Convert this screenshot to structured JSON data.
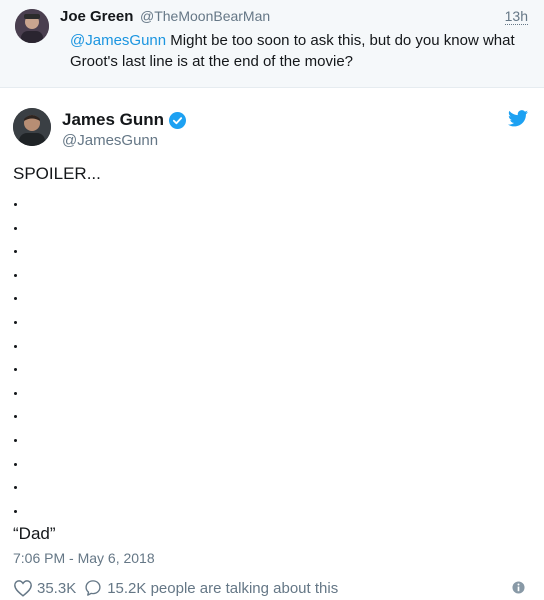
{
  "reply": {
    "name": "Joe Green",
    "handle": "@TheMoonBearMan",
    "time": "13h",
    "mention": "@JamesGunn",
    "text": " Might be too soon to ask this, but do you know what Groot's last line is at the end of the movie?"
  },
  "tweet": {
    "name": "James Gunn",
    "handle": "@JamesGunn",
    "line1": "SPOILER...",
    "dots": [
      ".",
      ".",
      ".",
      ".",
      ".",
      ".",
      ".",
      ".",
      ".",
      ".",
      ".",
      ".",
      ".",
      "."
    ],
    "last_line": "“Dad”",
    "timestamp": "7:06 PM - May 6, 2018"
  },
  "actions": {
    "likes": "35.3K",
    "talking": "15.2K people are talking about this"
  },
  "colors": {
    "link": "#1b95e0",
    "brand": "#1da1f2",
    "secondary": "#657786"
  },
  "icons": [
    "verified-badge-icon",
    "twitter-bird-icon",
    "heart-icon",
    "comment-bubble-icon",
    "info-icon"
  ]
}
